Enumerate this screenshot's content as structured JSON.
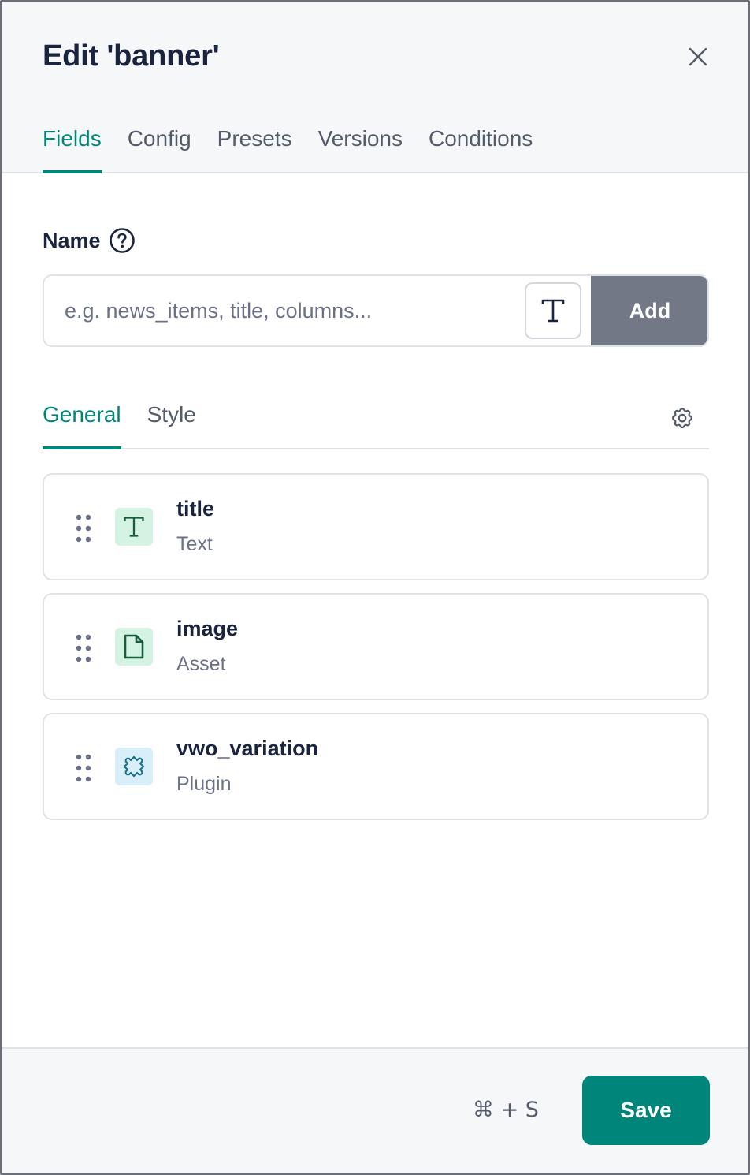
{
  "header": {
    "title": "Edit 'banner'",
    "tabs": [
      {
        "label": "Fields",
        "active": true
      },
      {
        "label": "Config",
        "active": false
      },
      {
        "label": "Presets",
        "active": false
      },
      {
        "label": "Versions",
        "active": false
      },
      {
        "label": "Conditions",
        "active": false
      }
    ]
  },
  "name_section": {
    "label": "Name",
    "input_value": "",
    "input_placeholder": "e.g. news_items, title, columns...",
    "type_icon": "text-type-icon",
    "add_label": "Add"
  },
  "subtabs": [
    {
      "label": "General",
      "active": true
    },
    {
      "label": "Style",
      "active": false
    }
  ],
  "fields": [
    {
      "name": "title",
      "type": "Text",
      "icon": "text-icon",
      "icon_bg": "#d5f3e3"
    },
    {
      "name": "image",
      "type": "Asset",
      "icon": "file-icon",
      "icon_bg": "#d5f3e3"
    },
    {
      "name": "vwo_variation",
      "type": "Plugin",
      "icon": "puzzle-icon",
      "icon_bg": "#d8effa"
    }
  ],
  "footer": {
    "shortcut": "⌘ + S",
    "save_label": "Save"
  },
  "colors": {
    "accent": "#00857a",
    "add_button": "#727886",
    "text_icon_green": "#1a5c3a",
    "plugin_icon_teal": "#1a6e8a"
  }
}
